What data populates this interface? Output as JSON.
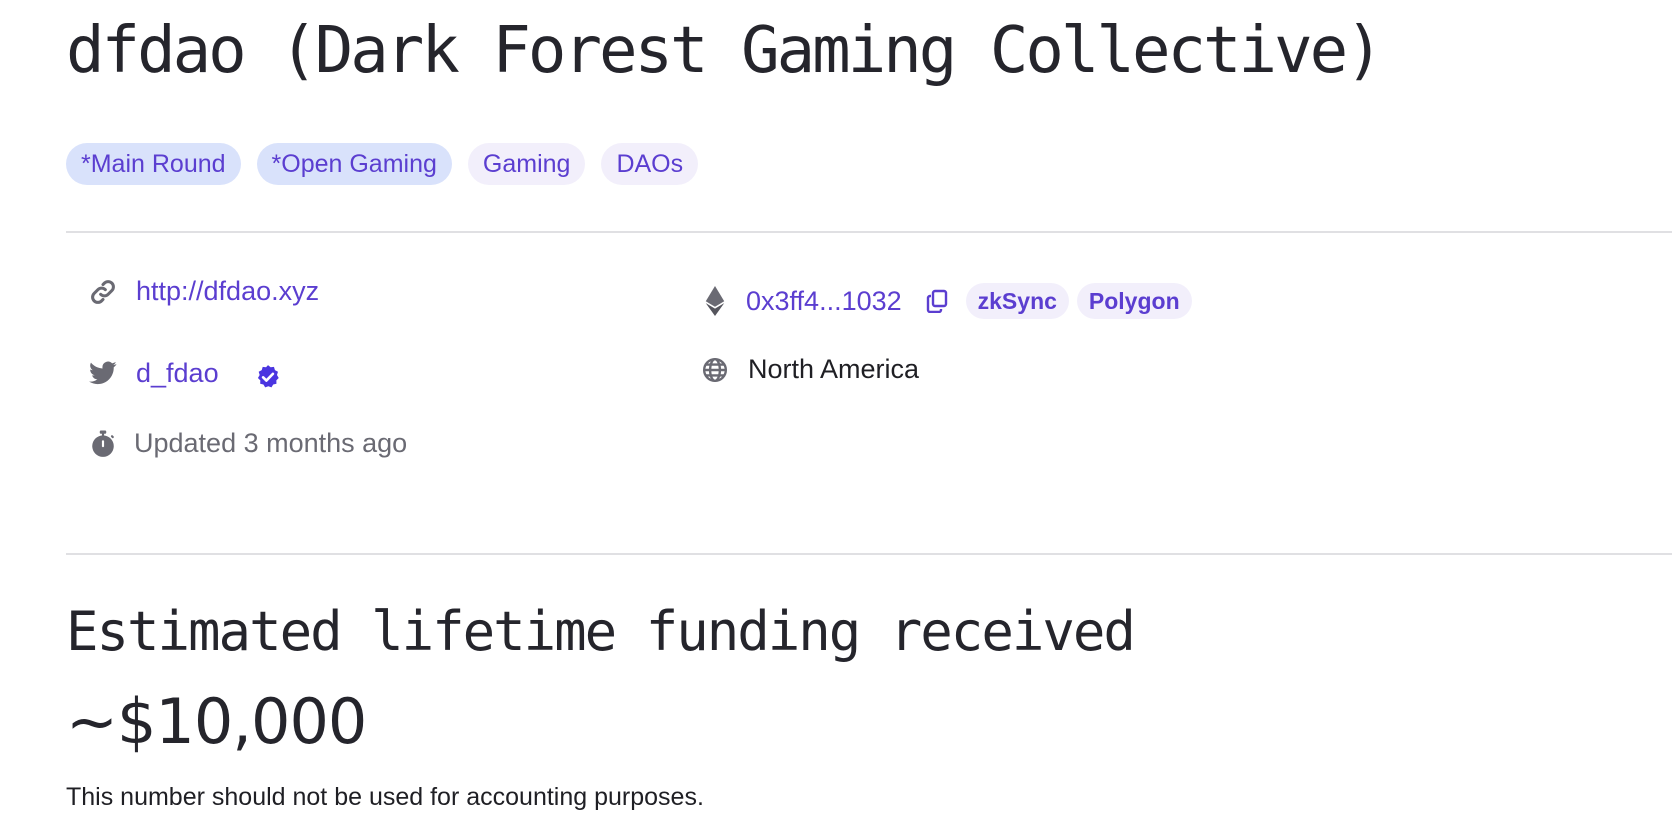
{
  "project": {
    "title": "dfdao (Dark Forest Gaming Collective)"
  },
  "tags": {
    "rounds": [
      "*Main Round",
      "*Open Gaming"
    ],
    "categories": [
      "Gaming",
      "DAOs"
    ]
  },
  "details": {
    "website": "http://dfdao.xyz",
    "twitter_handle": "d_fdao",
    "twitter_verified": true,
    "updated": "Updated 3 months ago",
    "wallet_address": "0x3ff4...1032",
    "chains": [
      "zkSync",
      "Polygon"
    ],
    "region": "North America"
  },
  "funding": {
    "heading": "Estimated lifetime funding received",
    "amount": "~$10,000",
    "disclaimer": "This number should not be used for accounting purposes."
  },
  "icons": {
    "website": "link-icon",
    "twitter": "twitter-icon",
    "verified": "verified-badge-icon",
    "updated": "stopwatch-icon",
    "wallet": "ethereum-icon",
    "copy": "copy-icon",
    "region": "globe-icon"
  },
  "colors": {
    "accent": "#5b3ed0",
    "round_tag_bg": "#d9e2fb",
    "category_tag_bg": "#f2effb",
    "divider": "#e0e0e3",
    "muted_text": "#6a6a73"
  }
}
